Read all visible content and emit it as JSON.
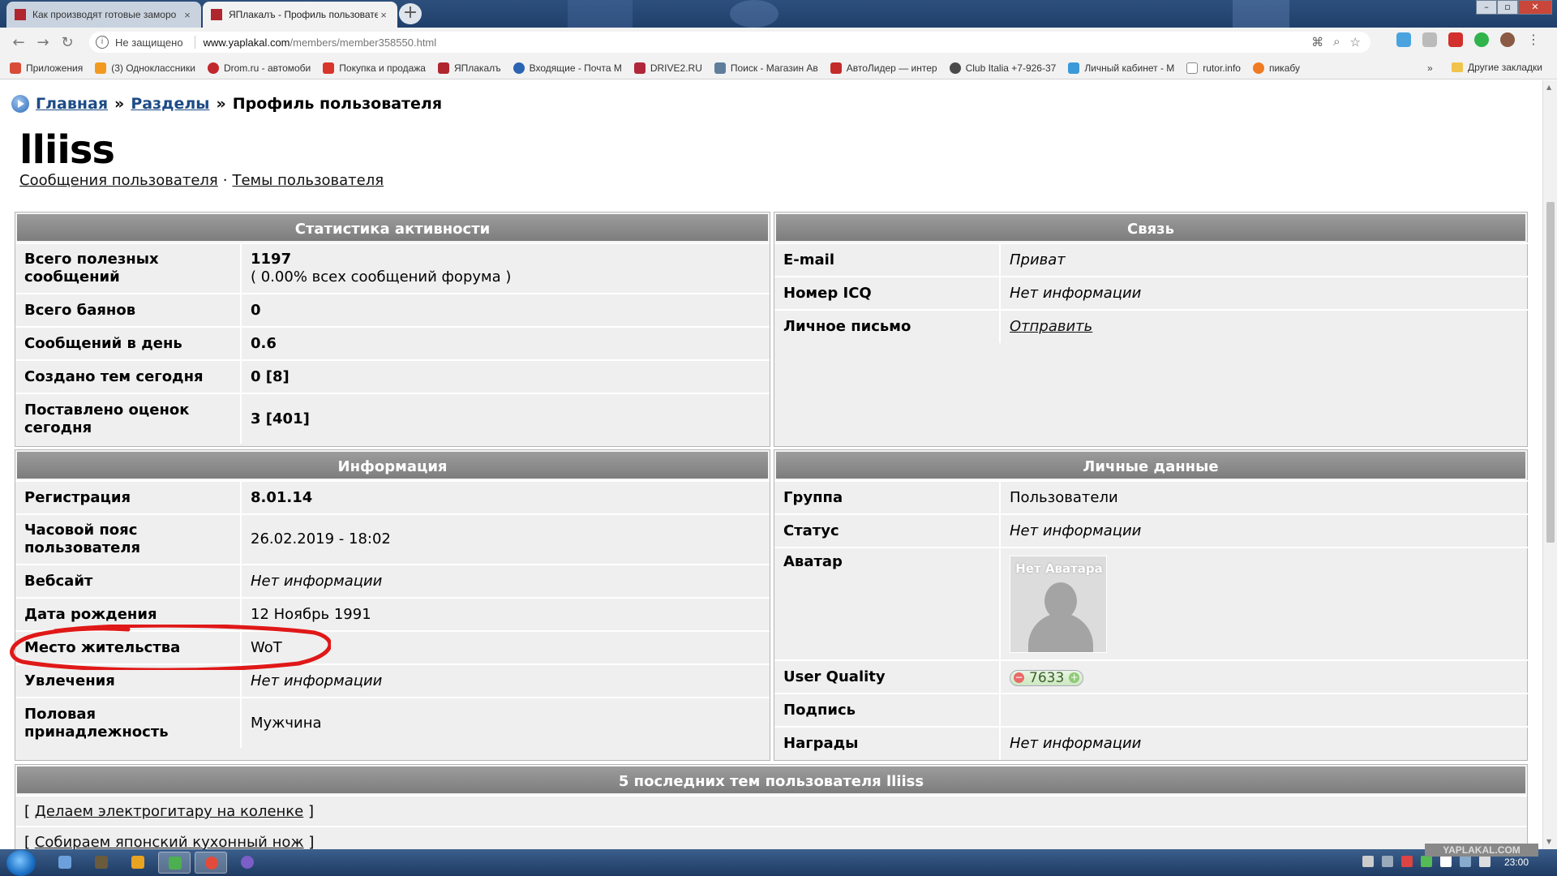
{
  "browser": {
    "tabs": [
      {
        "title": "Как производят готовые заморо",
        "active": false
      },
      {
        "title": "ЯПлакалъ - Профиль пользовате",
        "active": true
      }
    ],
    "new_tab_symbol": "+",
    "security_label": "Не защищено",
    "url_host": "www.yaplakal.com",
    "url_path": "/members/member358550.html",
    "bookmarks": [
      {
        "label": "Приложения",
        "color": "#d94b38"
      },
      {
        "label": "(3) Одноклассники",
        "color": "#f29a1f"
      },
      {
        "label": "Drom.ru - автомоби",
        "color": "#c0282e"
      },
      {
        "label": "Покупка и продажа",
        "color": "#d8352b"
      },
      {
        "label": "ЯПлакалъ",
        "color": "#b0262e"
      },
      {
        "label": "Входящие - Почта М",
        "color": "#2a64b3"
      },
      {
        "label": "DRIVE2.RU",
        "color": "#b0263a"
      },
      {
        "label": "Поиск - Магазин Ав",
        "color": "#607d9c"
      },
      {
        "label": "АвтоЛидер — интер",
        "color": "#c42b2b"
      },
      {
        "label": "Club Italia +7-926-37",
        "color": "#4a4a4a"
      },
      {
        "label": "Личный кабинет - М",
        "color": "#3a9ad9"
      },
      {
        "label": "rutor.info",
        "color": "#888888"
      },
      {
        "label": "пикабу",
        "color": "#f07b22"
      }
    ],
    "bookmarks_more": "»",
    "other_bookmarks": "Другие закладки"
  },
  "breadcrumb": {
    "home": "Главная",
    "sep": "»",
    "sections": "Разделы",
    "current": "Профиль пользователя"
  },
  "profile": {
    "username": "lliiss",
    "link_messages": "Сообщения пользователя",
    "link_sep": "·",
    "link_topics": "Темы пользователя"
  },
  "stats": {
    "title": "Статистика активности",
    "rows": [
      {
        "label": "Всего полезных сообщений",
        "value": "1197",
        "value2": "( 0.00% всех сообщений форума )"
      },
      {
        "label": "Всего баянов",
        "value": "0"
      },
      {
        "label": "Сообщений в день",
        "value": "0.6"
      },
      {
        "label": "Создано тем сегодня",
        "value": "0 [8]"
      },
      {
        "label": "Поставлено оценок сегодня",
        "value": "3 [401]"
      }
    ]
  },
  "contact": {
    "title": "Связь",
    "rows": [
      {
        "label": "E-mail",
        "value": "Приват"
      },
      {
        "label": "Номер ICQ",
        "value": "Нет информации"
      },
      {
        "label": "Личное письмо",
        "value": "Отправить"
      }
    ]
  },
  "info": {
    "title": "Информация",
    "rows": [
      {
        "label": "Регистрация",
        "value": "8.01.14"
      },
      {
        "label": "Часовой пояс пользователя",
        "value": "26.02.2019 - 18:02"
      },
      {
        "label": "Вебсайт",
        "value": "Нет информации"
      },
      {
        "label": "Дата рождения",
        "value": "12 Ноябрь 1991"
      },
      {
        "label": "Место жительства",
        "value": "WoT"
      },
      {
        "label": "Увлечения",
        "value": "Нет информации"
      },
      {
        "label": "Половая принадлежность",
        "value": "Мужчина"
      }
    ]
  },
  "personal": {
    "title": "Личные данные",
    "rows": [
      {
        "label": "Группа",
        "value": "Пользователи"
      },
      {
        "label": "Статус",
        "value": "Нет информации"
      },
      {
        "label": "Аватар",
        "avatar_text": "Нет Аватара"
      },
      {
        "label": "User Quality",
        "value": "7633",
        "minus": "−",
        "plus": "+"
      },
      {
        "label": "Подпись",
        "value": ""
      },
      {
        "label": "Награды",
        "value": "Нет информации"
      }
    ]
  },
  "topics": {
    "title": "5 последних тем пользователя lliiss",
    "bracket_open": "[",
    "bracket_close": "]",
    "items": [
      "Делаем электрогитару на коленке",
      "Собираем японский кухонный нож"
    ]
  },
  "taskbar": {
    "clock": "23:00"
  },
  "watermark": "YAPLAKAL.COM",
  "colors": {
    "accent_link": "#1d4b86",
    "panel_header": "#8a8a8a",
    "highlight_circle": "#e01818"
  }
}
